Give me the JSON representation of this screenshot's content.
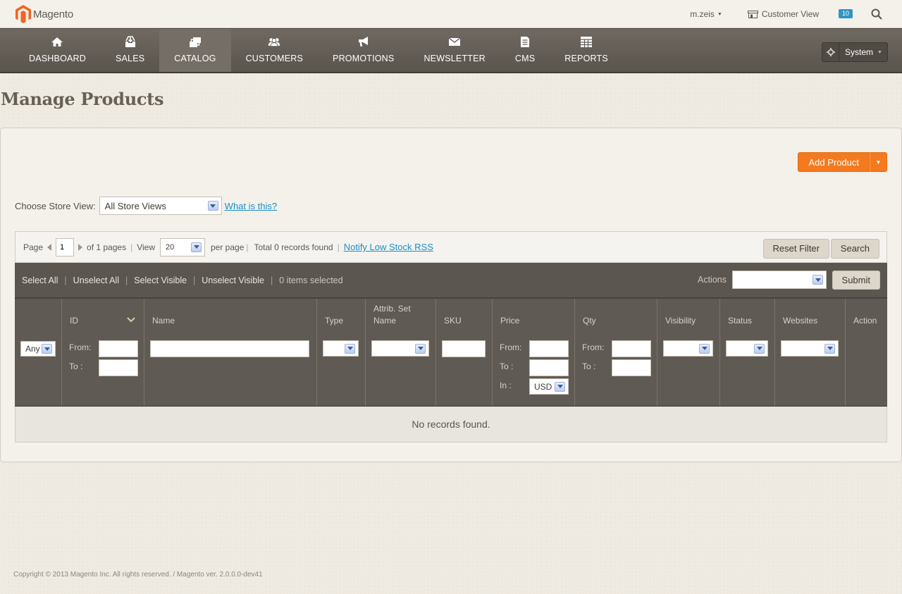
{
  "header": {
    "logo_text": "Magento",
    "user": "m.zeis",
    "customer_view": "Customer View",
    "notifications_count": "10"
  },
  "nav": {
    "items": [
      {
        "label": "DASHBOARD",
        "icon": "home-icon"
      },
      {
        "label": "SALES",
        "icon": "sales-icon"
      },
      {
        "label": "CATALOG",
        "icon": "catalog-icon",
        "active": true
      },
      {
        "label": "CUSTOMERS",
        "icon": "customers-icon"
      },
      {
        "label": "PROMOTIONS",
        "icon": "megaphone-icon"
      },
      {
        "label": "NEWSLETTER",
        "icon": "envelope-icon"
      },
      {
        "label": "CMS",
        "icon": "document-icon"
      },
      {
        "label": "REPORTS",
        "icon": "grid-icon"
      }
    ],
    "system_label": "System"
  },
  "page": {
    "title": "Manage Products",
    "add_product": "Add Product"
  },
  "store_view": {
    "label": "Choose Store View:",
    "value": "All Store Views",
    "help_link": "What is this?"
  },
  "pager": {
    "page_label": "Page",
    "page_value": "1",
    "of_pages": "of 1 pages",
    "view_label": "View",
    "view_value": "20",
    "per_page": "per page",
    "total": "Total 0 records found",
    "rss_link": "Notify Low Stock RSS",
    "reset_filter": "Reset Filter",
    "search": "Search"
  },
  "massaction": {
    "select_all": "Select All",
    "unselect_all": "Unselect All",
    "select_visible": "Select Visible",
    "unselect_visible": "Unselect Visible",
    "selected_count": "0 items selected",
    "actions_label": "Actions",
    "submit": "Submit"
  },
  "columns": {
    "id": "ID",
    "name": "Name",
    "type": "Type",
    "attrib_set_line1": "Attrib. Set",
    "attrib_set_line2": "Name",
    "sku": "SKU",
    "price": "Price",
    "qty": "Qty",
    "visibility": "Visibility",
    "status": "Status",
    "websites": "Websites",
    "action": "Action"
  },
  "filters": {
    "any": "Any",
    "from": "From:",
    "to": "To :",
    "in": "In :",
    "currency": "USD"
  },
  "grid": {
    "empty_message": "No records found."
  },
  "footer": {
    "copyright": "Copyright © 2013 Magento Inc. All rights reserved. / Magento ver. 2.0.0.0-dev41"
  }
}
